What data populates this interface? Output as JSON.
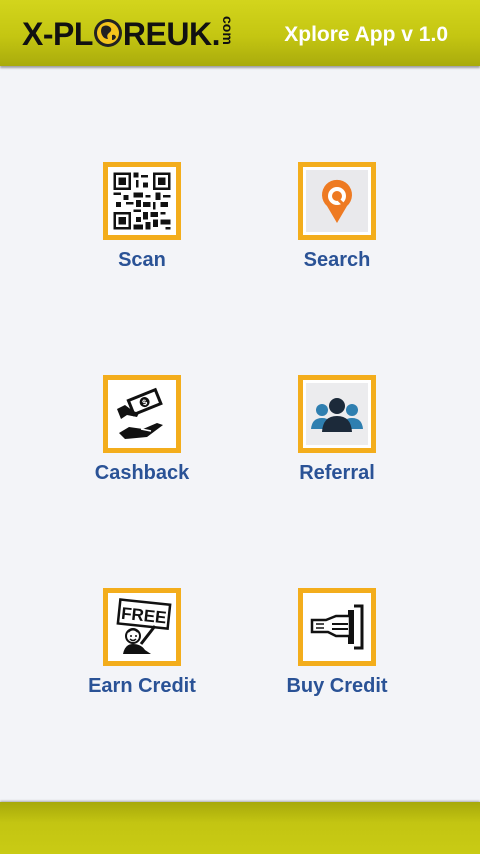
{
  "header": {
    "logo_text_left": "X-PL",
    "logo_text_right": "REUK.",
    "logo_suffix": "com",
    "app_title": "Xplore App v 1.0"
  },
  "menu": [
    {
      "label": "Scan",
      "icon": "qr-code-icon"
    },
    {
      "label": "Search",
      "icon": "map-pin-search-icon"
    },
    {
      "label": "Cashback",
      "icon": "cash-hand-icon"
    },
    {
      "label": "Referral",
      "icon": "people-group-icon"
    },
    {
      "label": "Earn Credit",
      "icon": "free-sign-icon"
    },
    {
      "label": "Buy Credit",
      "icon": "card-reader-icon"
    }
  ],
  "colors": {
    "header_bar": "#c4c612",
    "tile_border": "#f3ad1c",
    "label_text": "#2a5296",
    "background": "#f3f4f8"
  }
}
